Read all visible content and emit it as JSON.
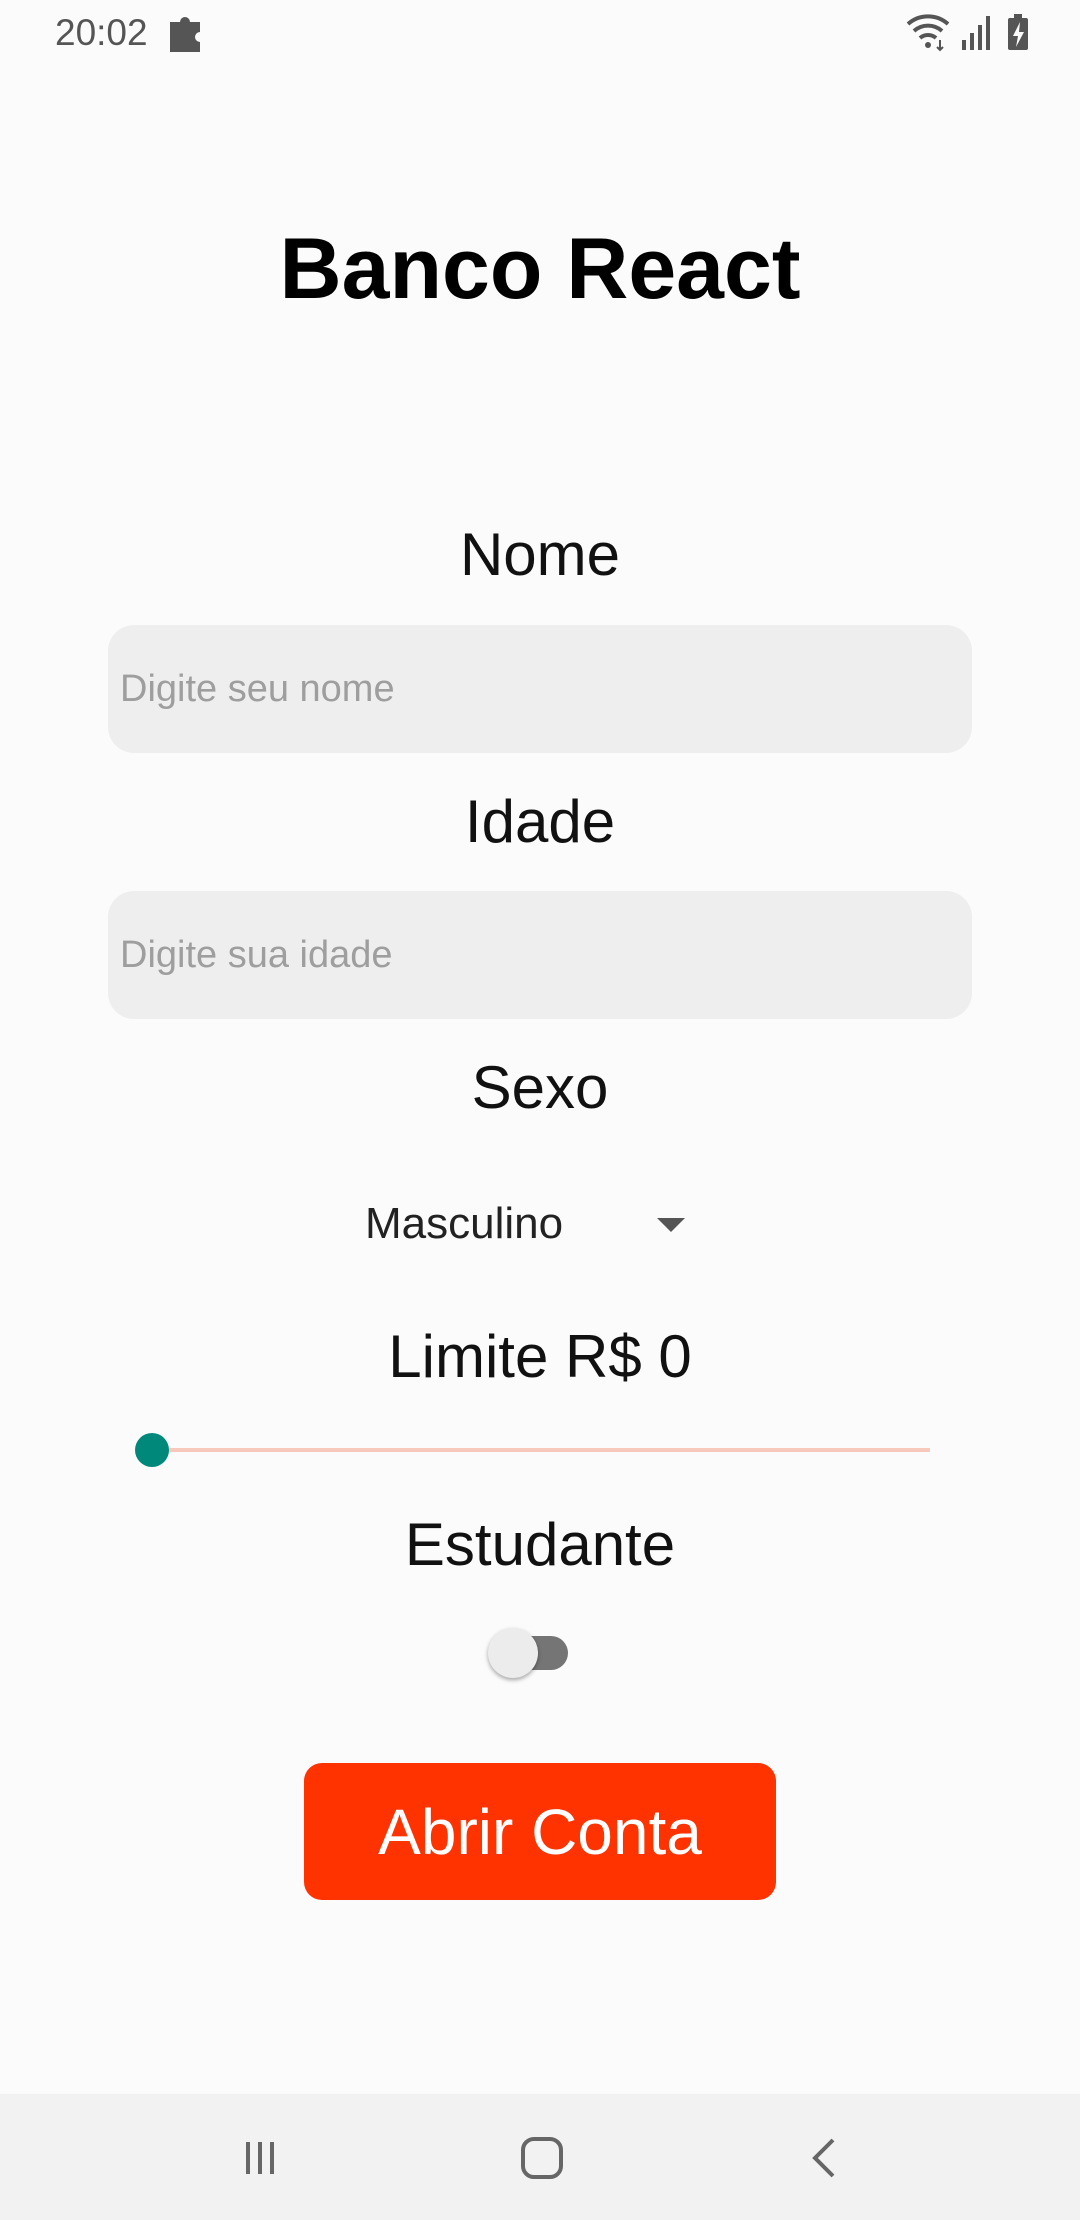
{
  "status_bar": {
    "time": "20:02",
    "icons": [
      "puzzle-icon",
      "wifi-icon",
      "signal-icon",
      "battery-charging-icon"
    ]
  },
  "app": {
    "title": "Banco React"
  },
  "form": {
    "name_label": "Nome",
    "name_placeholder": "Digite seu nome",
    "name_value": "",
    "age_label": "Idade",
    "age_placeholder": "Digite sua idade",
    "age_value": "",
    "sex_label": "Sexo",
    "sex_selected": "Masculino",
    "limit_label": "Limite R$ 0",
    "limit_value": 0,
    "student_label": "Estudante",
    "student_on": false,
    "submit_label": "Abrir Conta"
  },
  "colors": {
    "accent_button": "#ff3300",
    "slider_thumb": "#00897b",
    "slider_track": "#f8c8bc"
  },
  "nav_bar": {
    "icons": [
      "recents-icon",
      "home-icon",
      "back-icon"
    ]
  }
}
